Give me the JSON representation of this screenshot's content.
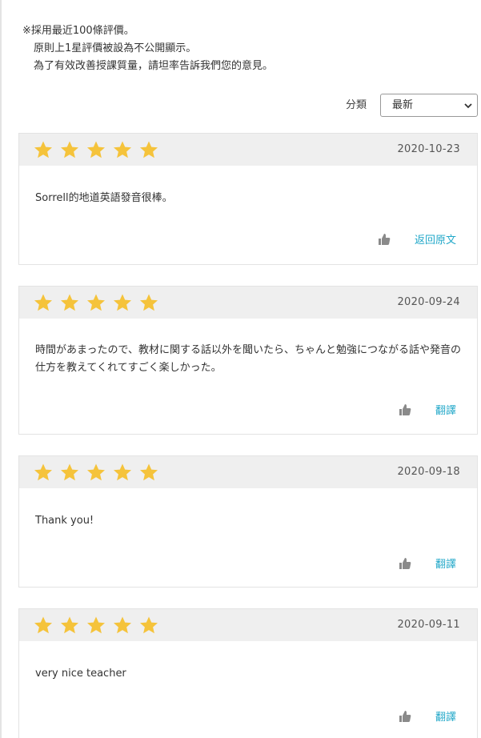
{
  "notice": {
    "line1": "※採用最近100條評價。",
    "line2": "原則上1星評價被設為不公開顯示。",
    "line3": "為了有效改善授課質量，請坦率告訴我們您的意見。"
  },
  "sort": {
    "label": "分類",
    "selected": "最新"
  },
  "colors": {
    "star": "#f5c33b",
    "link": "#22a8c9",
    "header_bg": "#efefef"
  },
  "reviews": [
    {
      "stars": 5,
      "date": "2020-10-23",
      "comment": "Sorrell的地道英語發音很棒。",
      "action": "返回原文"
    },
    {
      "stars": 5,
      "date": "2020-09-24",
      "comment": "時間があまったので、教材に関する話以外を聞いたら、ちゃんと勉強につながる話や発音の仕方を教えてくれてすごく楽しかった。",
      "action": "翻譯"
    },
    {
      "stars": 5,
      "date": "2020-09-18",
      "comment": "Thank you!",
      "action": "翻譯"
    },
    {
      "stars": 5,
      "date": "2020-09-11",
      "comment": "very nice teacher",
      "action": "翻譯"
    }
  ]
}
